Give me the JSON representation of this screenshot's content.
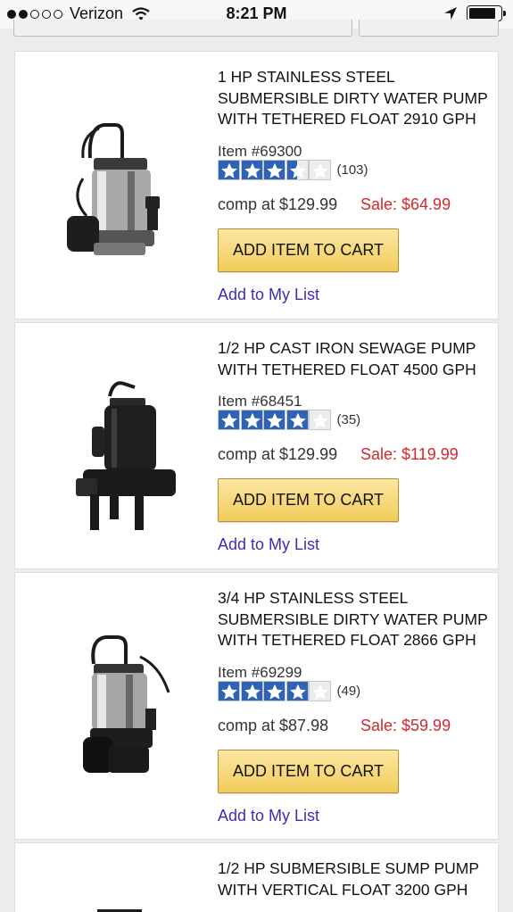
{
  "status_bar": {
    "carrier": "Verizon",
    "time": "8:21 PM",
    "signal_bars_filled": 2,
    "signal_bars_total": 5,
    "battery_level": 0.85
  },
  "products": [
    {
      "title": "1 HP STAINLESS STEEL SUBMERSIBLE DIRTY WATER PUMP WITH TETHERED FLOAT 2910 GPH",
      "item": "Item #69300",
      "rating": 3.5,
      "reviews": "(103)",
      "comp": "comp at $129.99",
      "sale": "Sale: $64.99",
      "cart_label": "ADD ITEM TO CART",
      "list_label": "Add to My List"
    },
    {
      "title": "1/2 HP CAST IRON SEWAGE PUMP WITH TETHERED FLOAT 4500 GPH",
      "item": "Item #68451",
      "rating": 4,
      "reviews": "(35)",
      "comp": "comp at $129.99",
      "sale": "Sale: $119.99",
      "cart_label": "ADD ITEM TO CART",
      "list_label": "Add to My List"
    },
    {
      "title": "3/4 HP STAINLESS STEEL SUBMERSIBLE DIRTY WATER PUMP WITH TETHERED FLOAT 2866 GPH",
      "item": "Item #69299",
      "rating": 4,
      "reviews": "(49)",
      "comp": "comp at $87.98",
      "sale": "Sale: $59.99",
      "cart_label": "ADD ITEM TO CART",
      "list_label": "Add to My List"
    },
    {
      "title": "1/2 HP SUBMERSIBLE SUMP PUMP WITH VERTICAL FLOAT 3200 GPH"
    }
  ],
  "colors": {
    "star_fill": "#2f63b6",
    "sale_price": "#d0282e",
    "link": "#3a2fb5",
    "cart_button": "#f2cc5b"
  }
}
